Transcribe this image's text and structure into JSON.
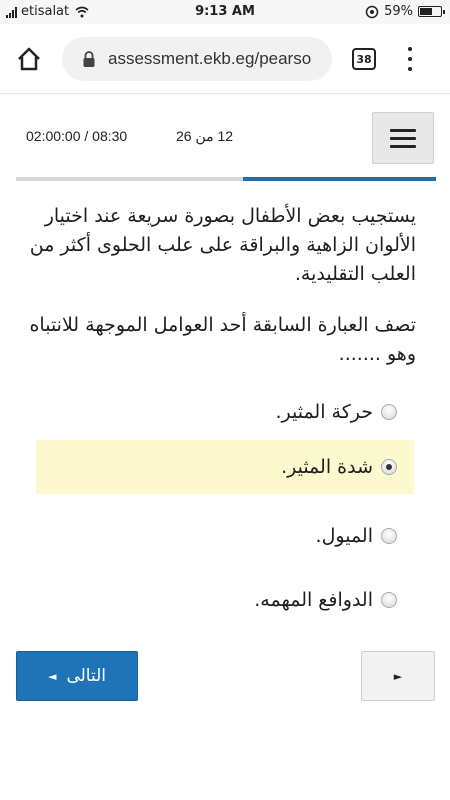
{
  "status_bar": {
    "carrier": "etisalat",
    "time": "9:13 AM",
    "battery_percent": "59%",
    "battery_level": 0.59,
    "icons": [
      "signal-icon",
      "wifi-icon",
      "data-saver-icon",
      "battery-icon"
    ]
  },
  "browser": {
    "url": "assessment.ekb.eg/pearso",
    "tab_count": "38",
    "icons": [
      "home-icon",
      "lock-icon",
      "tabs-icon",
      "more-vert-icon"
    ]
  },
  "quiz": {
    "timer": "02:00:00 / 08:30",
    "question_counter": "12 من 26",
    "progress_fraction": 0.46,
    "colors": {
      "accent": "#1f73b7",
      "selected_bg": "#fcf9cf",
      "progress_track": "#d6d6d6"
    },
    "question_part1": "يستجيب بعض الأطفال بصورة سريعة عند اختيار الألوان الزاهية والبراقة على علب الحلوى أكثر من العلب التقليدية.",
    "question_part2": "تصف العبارة السابقة أحد العوامل الموجهة للانتباه وهو .......",
    "options": [
      {
        "label": "حركة المثير.",
        "selected": false
      },
      {
        "label": "شدة المثير.",
        "selected": true
      },
      {
        "label": "الميول.",
        "selected": false
      },
      {
        "label": "الدوافع المهمه.",
        "selected": false
      }
    ],
    "next_label": "التالى",
    "next_arrow": "◄",
    "page_button_arrow": "►"
  }
}
